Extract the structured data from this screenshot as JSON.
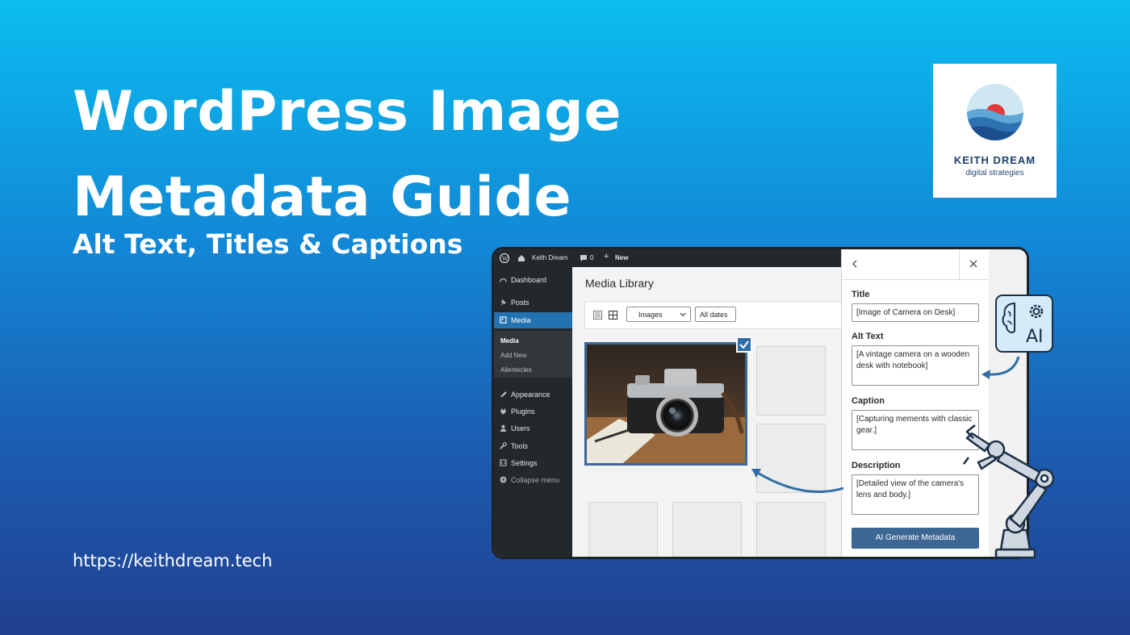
{
  "hero": {
    "title_line1": "WordPress Image",
    "title_line2": "Metadata Guide",
    "subtitle": "Alt Text, Titles & Captions",
    "url": "https://keithdream.tech"
  },
  "logo": {
    "name": "KEITH DREAM",
    "tagline": "digital strategies",
    "icon": "sun-over-waves-logo"
  },
  "adminbar": {
    "site_name": "Keith Dream",
    "comments_count": "0",
    "new_label": "New",
    "icons": [
      "wordpress-icon",
      "home-icon",
      "comment-icon",
      "plus-icon"
    ]
  },
  "sidebar": {
    "items": [
      {
        "label": "Dashboard",
        "icon": "gauge-icon"
      },
      {
        "label": "Posts",
        "icon": "pin-icon"
      },
      {
        "label": "Media",
        "icon": "media-icon",
        "active": true
      },
      {
        "label": "Appearance",
        "icon": "brush-icon"
      },
      {
        "label": "Plugins",
        "icon": "plug-icon"
      },
      {
        "label": "Users",
        "icon": "user-icon"
      },
      {
        "label": "Tools",
        "icon": "wrench-icon"
      },
      {
        "label": "Settings",
        "icon": "settings-icon"
      },
      {
        "label": "Collapse menu",
        "icon": "collapse-icon"
      }
    ],
    "submenu": [
      "Media",
      "Add New",
      "Allentecles"
    ]
  },
  "library": {
    "heading": "Media Library",
    "filter_type": "Images",
    "filter_dates": "All dates",
    "view_icons": [
      "list-view-icon",
      "grid-view-icon"
    ]
  },
  "details_panel": {
    "title_label": "Title",
    "title_value": "[Image of Camera on Desk]",
    "alt_label": "Alt Text",
    "alt_value": "[A vintage camera on a wooden desk with notebook]",
    "caption_label": "Caption",
    "caption_value": "[Capturing mements with classic gear.]",
    "description_label": "Description",
    "description_value": "[Detailed view of the camera's lens and body.]",
    "generate_button": "AI Generate Metadata"
  },
  "ai_badge": {
    "label": "AI",
    "icon": "brain-gear-icon"
  },
  "colors": {
    "bg_top": "#0bbdf0",
    "bg_bottom": "#21408f",
    "wp_sidebar": "#23282d",
    "wp_accent": "#2271b1",
    "button": "#3c6794"
  }
}
